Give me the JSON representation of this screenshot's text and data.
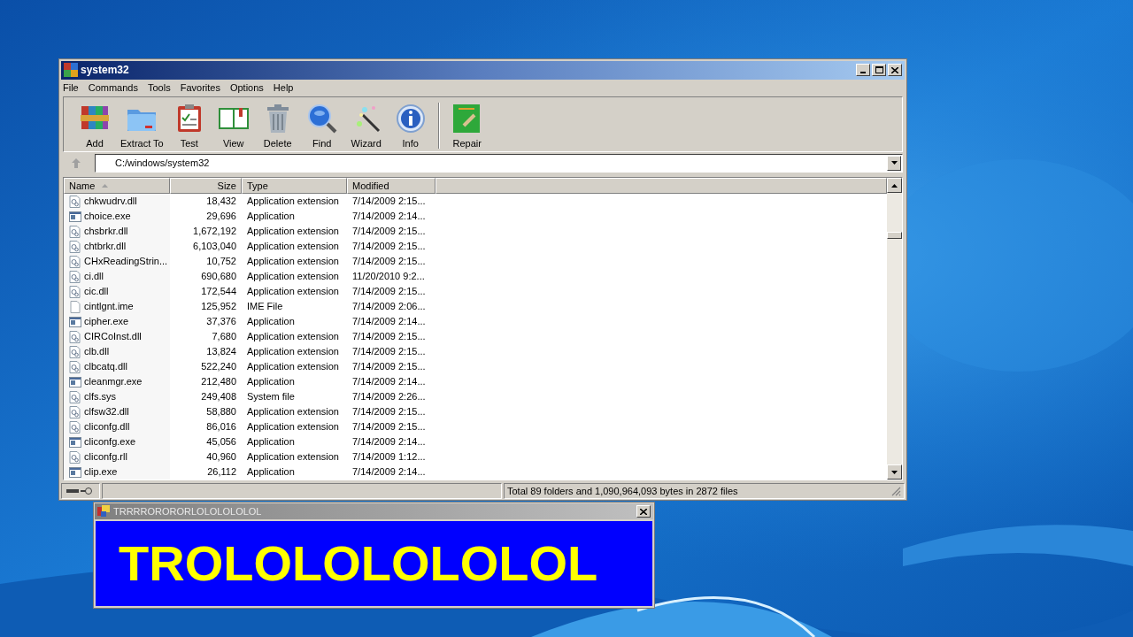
{
  "window": {
    "title": "system32"
  },
  "menu": [
    "File",
    "Commands",
    "Tools",
    "Favorites",
    "Options",
    "Help"
  ],
  "toolbar": [
    {
      "label": "Add",
      "kind": "add"
    },
    {
      "label": "Extract To",
      "kind": "extract"
    },
    {
      "label": "Test",
      "kind": "test"
    },
    {
      "label": "View",
      "kind": "view"
    },
    {
      "label": "Delete",
      "kind": "delete"
    },
    {
      "label": "Find",
      "kind": "find"
    },
    {
      "label": "Wizard",
      "kind": "wizard"
    },
    {
      "label": "Info",
      "kind": "info"
    },
    {
      "label": "Repair",
      "kind": "repair"
    }
  ],
  "address": {
    "value": "C:/windows/system32"
  },
  "table": {
    "columns": [
      {
        "label": "Name",
        "sorted": true
      },
      {
        "label": "Size"
      },
      {
        "label": "Type"
      },
      {
        "label": "Modified"
      }
    ],
    "rows": [
      {
        "kind": "dll",
        "name": "chkwudrv.dll",
        "size": "18,432",
        "type": "Application extension",
        "modified": "7/14/2009 2:15..."
      },
      {
        "kind": "exe",
        "name": "choice.exe",
        "size": "29,696",
        "type": "Application",
        "modified": "7/14/2009 2:14..."
      },
      {
        "kind": "dll",
        "name": "chsbrkr.dll",
        "size": "1,672,192",
        "type": "Application extension",
        "modified": "7/14/2009 2:15..."
      },
      {
        "kind": "dll",
        "name": "chtbrkr.dll",
        "size": "6,103,040",
        "type": "Application extension",
        "modified": "7/14/2009 2:15..."
      },
      {
        "kind": "dll",
        "name": "CHxReadingStrin...",
        "size": "10,752",
        "type": "Application extension",
        "modified": "7/14/2009 2:15..."
      },
      {
        "kind": "dll",
        "name": "ci.dll",
        "size": "690,680",
        "type": "Application extension",
        "modified": "11/20/2010 9:2..."
      },
      {
        "kind": "dll",
        "name": "cic.dll",
        "size": "172,544",
        "type": "Application extension",
        "modified": "7/14/2009 2:15..."
      },
      {
        "kind": "plain",
        "name": "cintlgnt.ime",
        "size": "125,952",
        "type": "IME File",
        "modified": "7/14/2009 2:06..."
      },
      {
        "kind": "exe",
        "name": "cipher.exe",
        "size": "37,376",
        "type": "Application",
        "modified": "7/14/2009 2:14..."
      },
      {
        "kind": "dll",
        "name": "CIRCoInst.dll",
        "size": "7,680",
        "type": "Application extension",
        "modified": "7/14/2009 2:15..."
      },
      {
        "kind": "dll",
        "name": "clb.dll",
        "size": "13,824",
        "type": "Application extension",
        "modified": "7/14/2009 2:15..."
      },
      {
        "kind": "dll",
        "name": "clbcatq.dll",
        "size": "522,240",
        "type": "Application extension",
        "modified": "7/14/2009 2:15..."
      },
      {
        "kind": "exe",
        "name": "cleanmgr.exe",
        "size": "212,480",
        "type": "Application",
        "modified": "7/14/2009 2:14..."
      },
      {
        "kind": "dll",
        "name": "clfs.sys",
        "size": "249,408",
        "type": "System file",
        "modified": "7/14/2009 2:26..."
      },
      {
        "kind": "dll",
        "name": "clfsw32.dll",
        "size": "58,880",
        "type": "Application extension",
        "modified": "7/14/2009 2:15..."
      },
      {
        "kind": "dll",
        "name": "cliconfg.dll",
        "size": "86,016",
        "type": "Application extension",
        "modified": "7/14/2009 2:15..."
      },
      {
        "kind": "exe",
        "name": "cliconfg.exe",
        "size": "45,056",
        "type": "Application",
        "modified": "7/14/2009 2:14..."
      },
      {
        "kind": "dll",
        "name": "cliconfg.rll",
        "size": "40,960",
        "type": "Application extension",
        "modified": "7/14/2009 1:12..."
      },
      {
        "kind": "exe",
        "name": "clip.exe",
        "size": "26,112",
        "type": "Application",
        "modified": "7/14/2009 2:14..."
      }
    ]
  },
  "status_bar": "Total 89 folders and 1,090,964,093 bytes in 2872 files",
  "popup": {
    "title": "TRRRRORORORLOLOLOLOLOL",
    "message": "TROLOLOLOLOLOL"
  }
}
